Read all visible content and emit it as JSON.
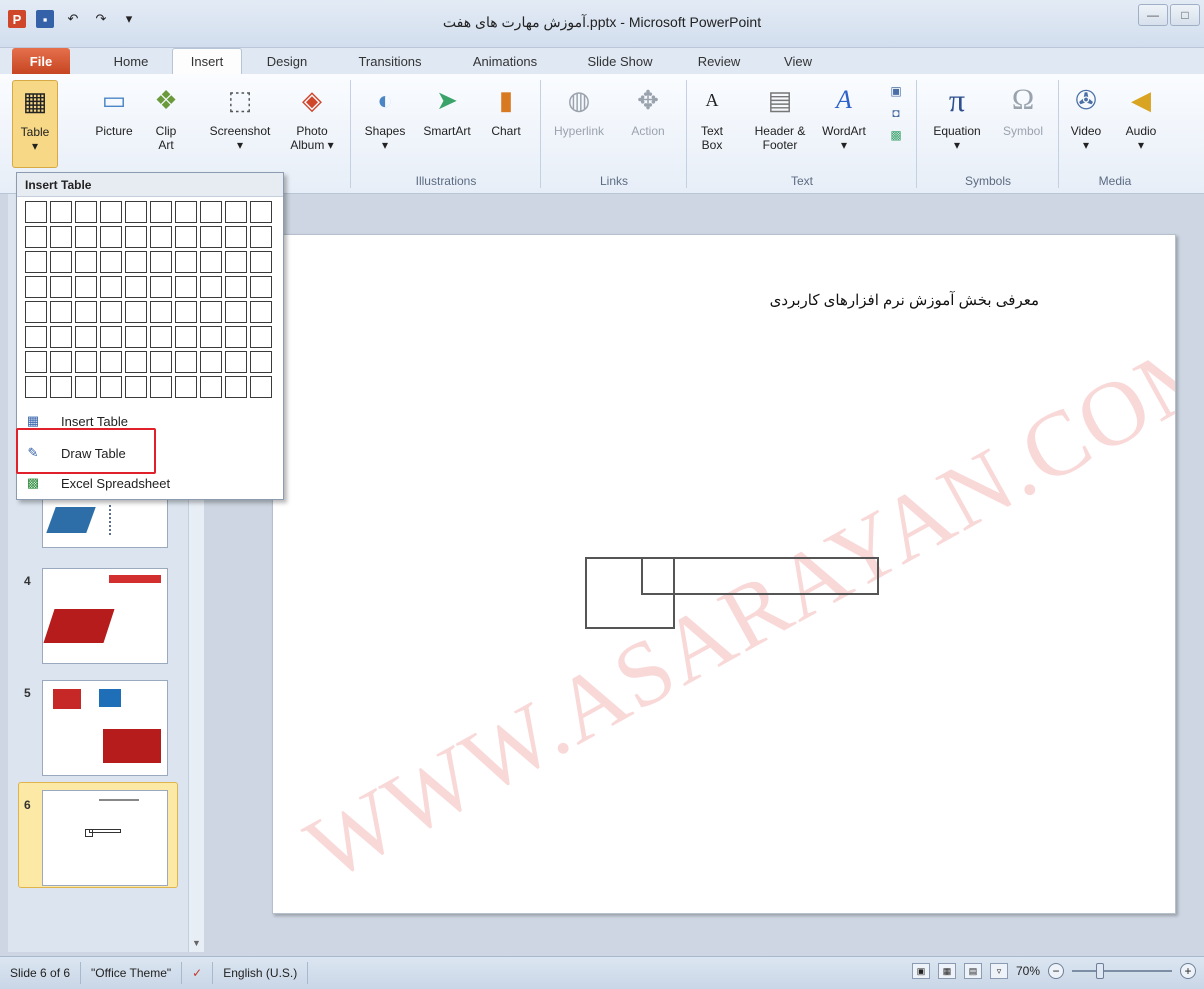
{
  "window": {
    "title": "آموزش مهارت های هفت.pptx - Microsoft PowerPoint",
    "min_label": "—",
    "max_label": "□"
  },
  "tabs": [
    {
      "label": "File"
    },
    {
      "label": "Home"
    },
    {
      "label": "Insert"
    },
    {
      "label": "Design"
    },
    {
      "label": "Transitions"
    },
    {
      "label": "Animations"
    },
    {
      "label": "Slide Show"
    },
    {
      "label": "Review"
    },
    {
      "label": "View"
    }
  ],
  "ribbon": {
    "table": {
      "label": "Table"
    },
    "picture": {
      "label": "Picture"
    },
    "clipart": {
      "label": "Clip Art"
    },
    "screenshot": {
      "label": "Screenshot"
    },
    "photoalbum": {
      "label": "Photo Album ▾"
    },
    "shapes": {
      "label": "Shapes"
    },
    "smartart": {
      "label": "SmartArt"
    },
    "chart": {
      "label": "Chart"
    },
    "hyperlink": {
      "label": "Hyperlink"
    },
    "action": {
      "label": "Action"
    },
    "textbox": {
      "label": "Text Box"
    },
    "headerfooter": {
      "label": "Header & Footer"
    },
    "wordart": {
      "label": "WordArt"
    },
    "equation": {
      "label": "Equation"
    },
    "symbol": {
      "label": "Symbol"
    },
    "video": {
      "label": "Video"
    },
    "audio": {
      "label": "Audio"
    },
    "groups": {
      "illustrations": "Illustrations",
      "links": "Links",
      "text": "Text",
      "symbols": "Symbols",
      "media": "Media"
    }
  },
  "dropdown": {
    "title": "Insert Table",
    "items": [
      {
        "label": "Insert Table"
      },
      {
        "label": "Draw Table"
      },
      {
        "label": "Excel Spreadsheet"
      }
    ]
  },
  "slides": [
    {
      "num": "4"
    },
    {
      "num": "5"
    },
    {
      "num": "6"
    }
  ],
  "slide": {
    "text": "معرفی بخش آموزش نرم افزارهای کاربردی",
    "watermark": "WWW.ASARAYAN.COM"
  },
  "status": {
    "slide_info": "Slide 6 of 6",
    "theme": "\"Office Theme\"",
    "language": "English (U.S.)",
    "zoom": "70%"
  },
  "colors": {
    "file_tab": "#c64522",
    "highlight": "#e0202a",
    "selected_thumb": "#fde9a6"
  }
}
